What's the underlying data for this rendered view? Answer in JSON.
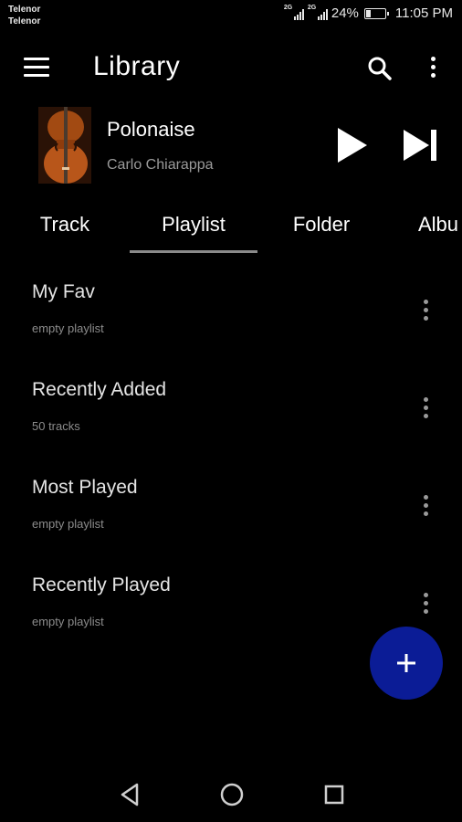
{
  "status_bar": {
    "carrier_1": "Telenor",
    "carrier_2": "Telenor",
    "sim_1_tag": "2G",
    "sim_2_tag": "2G",
    "battery_percent": "24%",
    "battery_level": 0.24,
    "time": "11:05 PM"
  },
  "app_bar": {
    "title": "Library",
    "menu_icon": "menu-icon",
    "search_icon": "search-icon",
    "more_icon": "more-vert-icon"
  },
  "now_playing": {
    "title": "Polonaise",
    "artist": "Carlo Chiarappa",
    "play_icon": "play-icon",
    "next_icon": "skip-next-icon"
  },
  "tabs": [
    {
      "label": "Track",
      "selected": false
    },
    {
      "label": "Playlist",
      "selected": true
    },
    {
      "label": "Folder",
      "selected": false
    },
    {
      "label": "Albu",
      "selected": false
    }
  ],
  "playlists": [
    {
      "title": "My Fav",
      "subtitle": "empty playlist"
    },
    {
      "title": "Recently Added",
      "subtitle": "50 tracks"
    },
    {
      "title": "Most Played",
      "subtitle": "empty playlist"
    },
    {
      "title": "Recently Played",
      "subtitle": "empty playlist"
    }
  ],
  "fab": {
    "icon": "add-icon",
    "color": "#0b1c96"
  },
  "nav_bar": {
    "back_icon": "back-icon",
    "home_icon": "home-icon",
    "recents_icon": "recents-icon"
  }
}
